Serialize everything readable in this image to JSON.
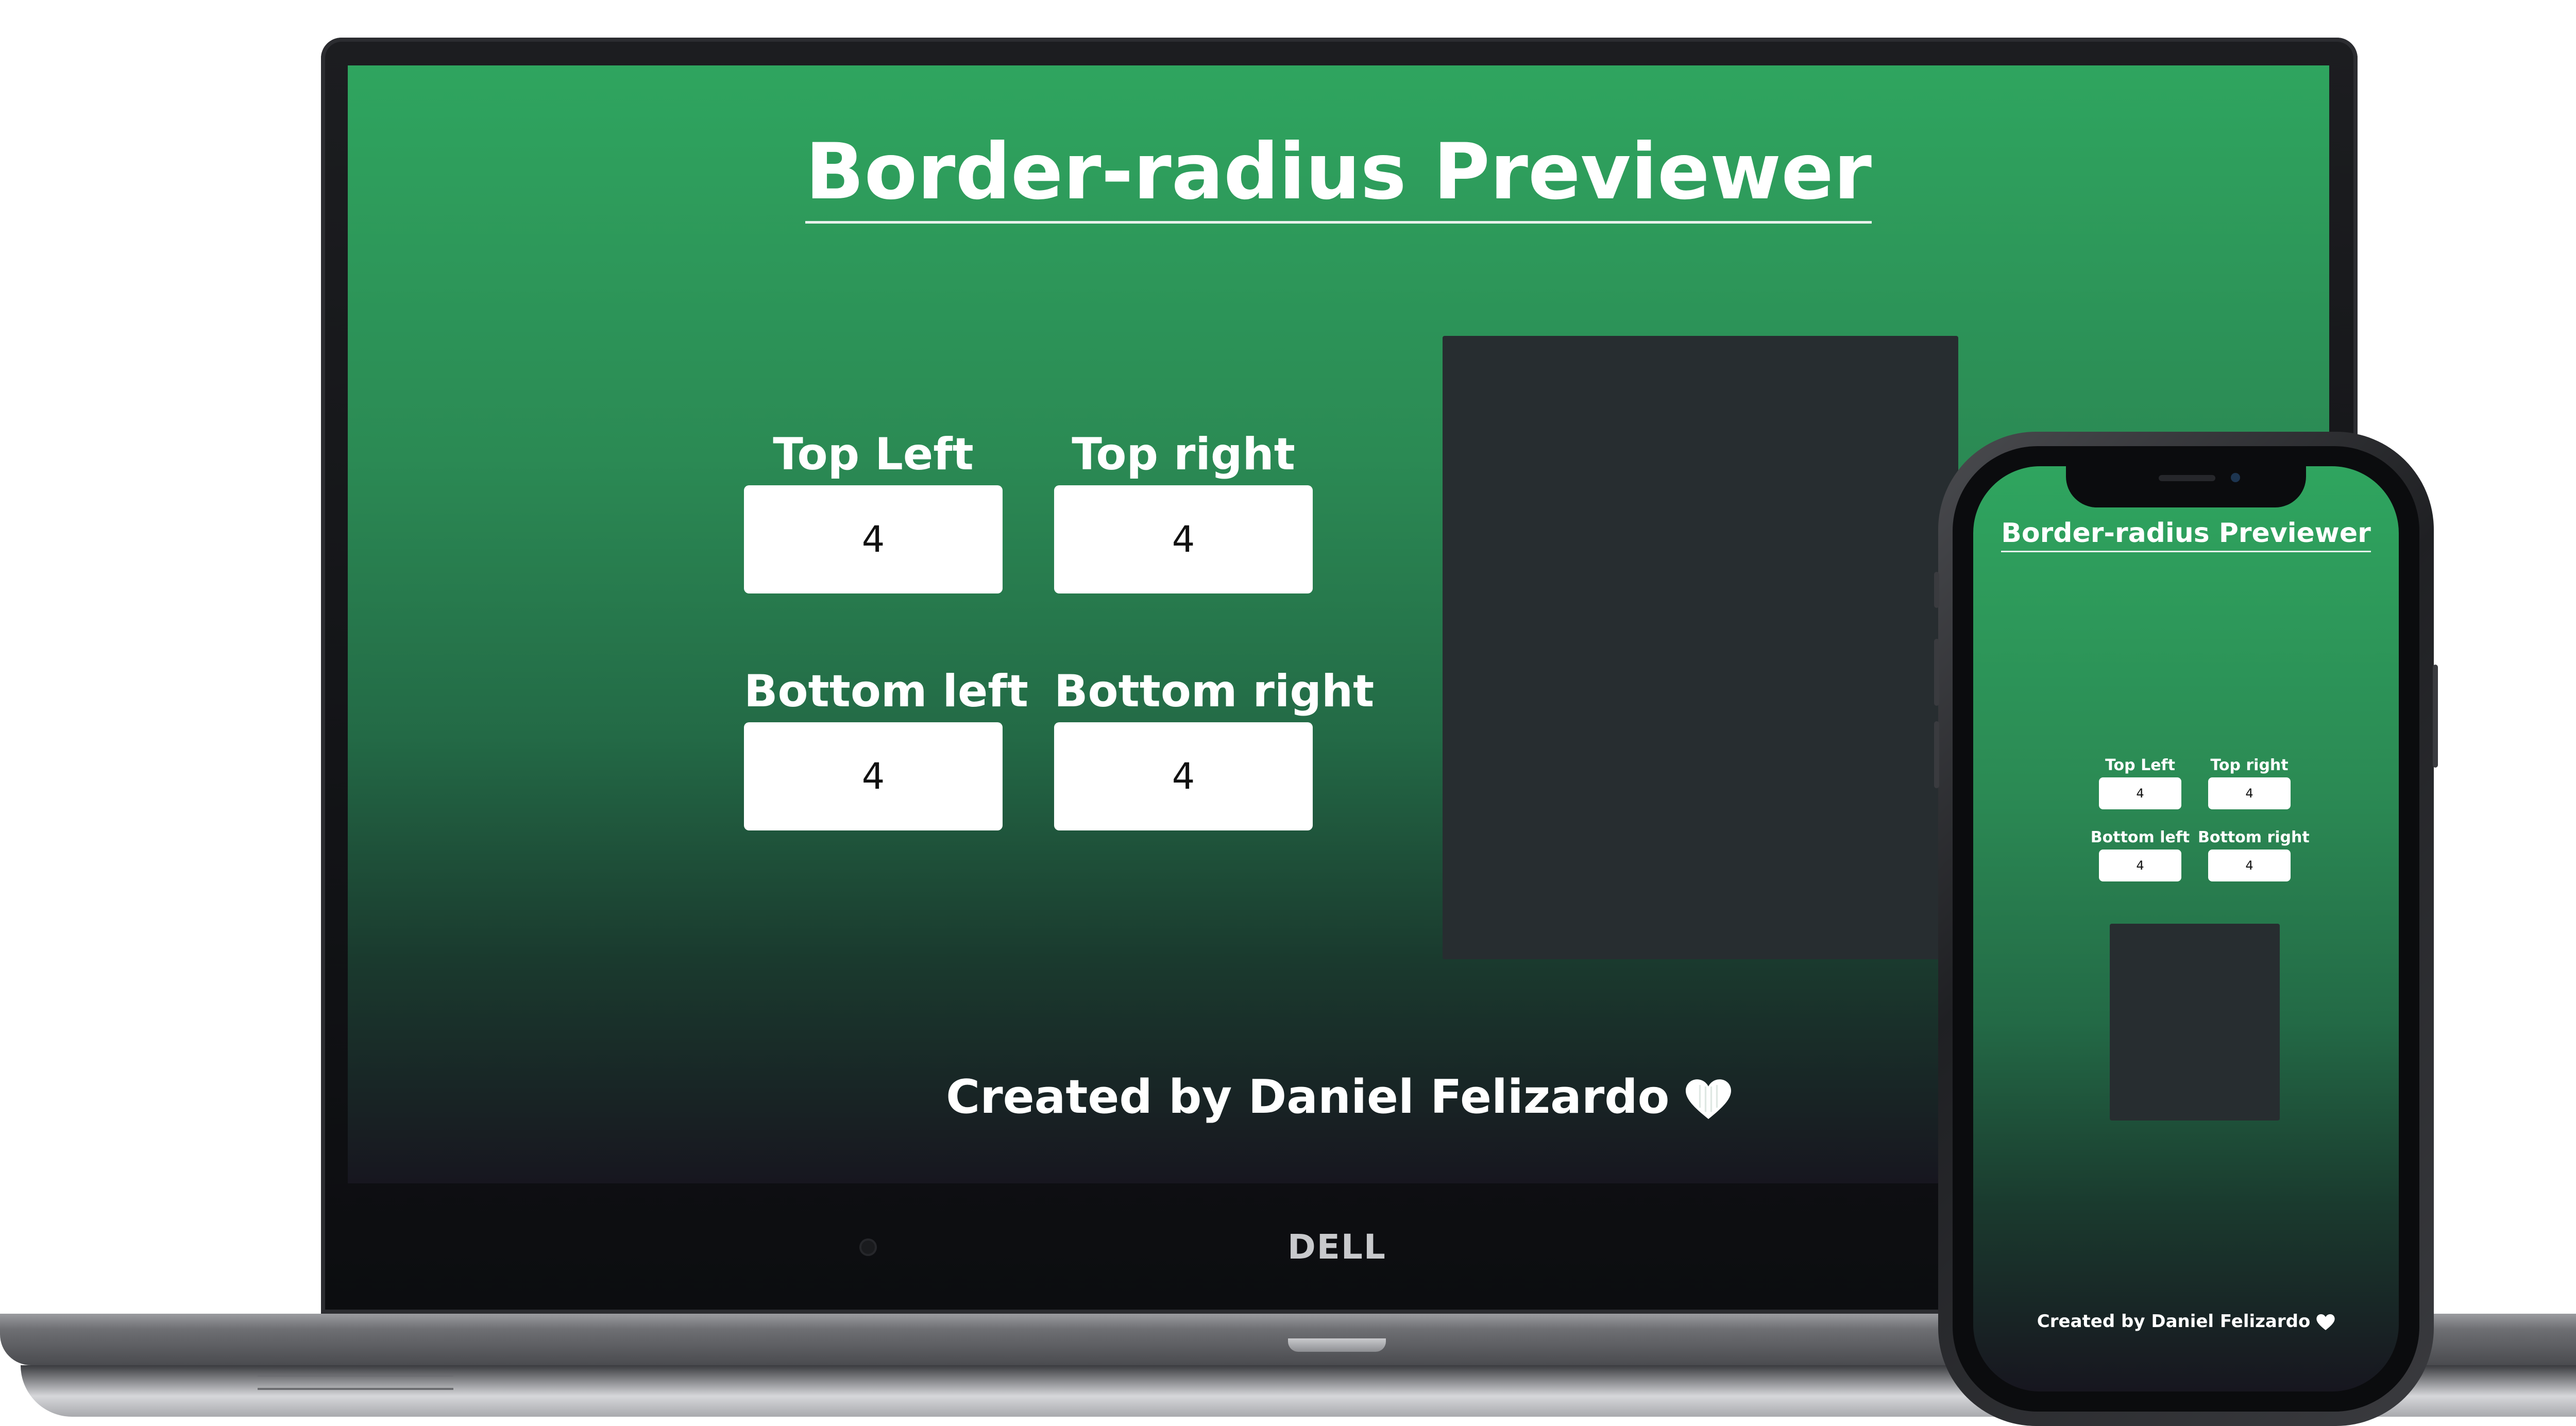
{
  "app": {
    "title": "Border-radius Previewer",
    "fields": {
      "top_left": {
        "label": "Top Left",
        "value": "4"
      },
      "top_right": {
        "label": "Top right",
        "value": "4"
      },
      "bottom_left": {
        "label": "Bottom left",
        "value": "4"
      },
      "bottom_right": {
        "label": "Bottom right",
        "value": "4"
      }
    },
    "footer": "Created by Daniel Felizardo"
  },
  "device": {
    "laptop_brand": "DELL"
  },
  "icons": {
    "footer_icon": "heart-icon"
  },
  "colors": {
    "gradient_top": "#2fa55f",
    "gradient_bottom": "#17161f",
    "preview_box": "#272d30",
    "text": "#ffffff"
  }
}
